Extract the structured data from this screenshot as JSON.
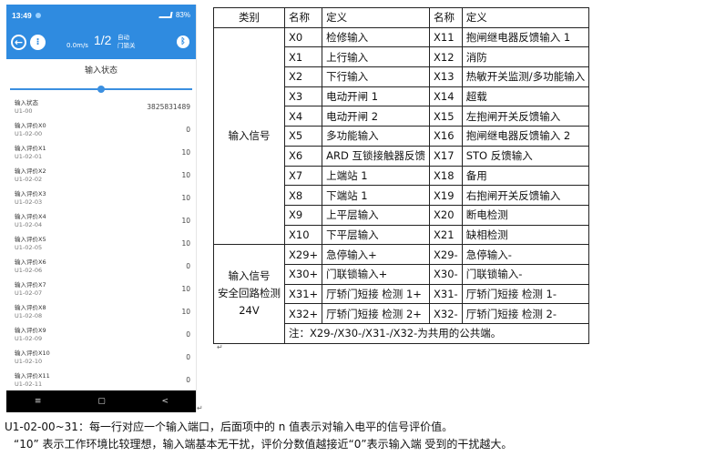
{
  "phone": {
    "status": {
      "time": "13:49",
      "battery": "83%"
    },
    "appbar": {
      "speed": "0.0m/s",
      "floor": "1/2",
      "mode": "自动",
      "door": "门锁关"
    },
    "title": "输入状态",
    "slider": {
      "position_fraction": 0.5
    },
    "rows": [
      {
        "label": "输入状态",
        "code": "U1-00",
        "value": "3825831489"
      },
      {
        "label": "输入评价X0",
        "code": "U1-02-00",
        "value": "0"
      },
      {
        "label": "输入评价X1",
        "code": "U1-02-01",
        "value": "10"
      },
      {
        "label": "输入评价X2",
        "code": "U1-02-02",
        "value": "10"
      },
      {
        "label": "输入评价X3",
        "code": "U1-02-03",
        "value": "10"
      },
      {
        "label": "输入评价X4",
        "code": "U1-02-04",
        "value": "10"
      },
      {
        "label": "输入评价X5",
        "code": "U1-02-05",
        "value": "10"
      },
      {
        "label": "输入评价X6",
        "code": "U1-02-06",
        "value": "0"
      },
      {
        "label": "输入评价X7",
        "code": "U1-02-07",
        "value": "10"
      },
      {
        "label": "输入评价X8",
        "code": "U1-02-08",
        "value": "10"
      },
      {
        "label": "输入评价X9",
        "code": "U1-02-09",
        "value": "0"
      },
      {
        "label": "输入评价X10",
        "code": "U1-02-10",
        "value": "0"
      },
      {
        "label": "输入评价X11",
        "code": "U1-02-11",
        "value": "0"
      }
    ],
    "nav": {
      "menu": "≡",
      "home": "▢",
      "back": "<"
    }
  },
  "table": {
    "headers": [
      "类别",
      "名称",
      "定义",
      "名称",
      "定义"
    ],
    "group1_label": "输入信号",
    "group1_rows": [
      [
        "X0",
        "检修输入",
        "X11",
        "抱闸继电器反馈输入 1"
      ],
      [
        "X1",
        "上行输入",
        "X12",
        "消防"
      ],
      [
        "X2",
        "下行输入",
        "X13",
        "热敏开关监测/多功能输入"
      ],
      [
        "X3",
        "电动开闸 1",
        "X14",
        "超载"
      ],
      [
        "X4",
        "电动开闸 2",
        "X15",
        "左抱闸开关反馈输入"
      ],
      [
        "X5",
        "多功能输入",
        "X16",
        "抱闸继电器反馈输入 2"
      ],
      [
        "X6",
        "ARD 互锁接触器反馈",
        "X17",
        "STO 反馈输入"
      ],
      [
        "X7",
        "上端站 1",
        "X18",
        "备用"
      ],
      [
        "X8",
        "下端站 1",
        "X19",
        "右抱闸开关反馈输入"
      ],
      [
        "X9",
        "上平层输入",
        "X20",
        "断电检测"
      ],
      [
        "X10",
        "下平层输入",
        "X21",
        "缺相检测"
      ]
    ],
    "group2_label": [
      "输入信号",
      "安全回路检测",
      "24V"
    ],
    "group2_rows": [
      [
        "X29+",
        "急停输入+",
        "X29-",
        "急停输入-"
      ],
      [
        "X30+",
        "门联锁输入+",
        "X30-",
        "门联锁输入-"
      ],
      [
        "X31+",
        "厅轿门短接 检测 1+",
        "X31-",
        "厅轿门短接 检测 1-"
      ],
      [
        "X32+",
        "厅轿门短接 检测 2+",
        "X32-",
        "厅轿门短接 检测 2-"
      ]
    ],
    "note": "注：X29-/X30-/X31-/X32-为共用的公共端。"
  },
  "body_text": {
    "line1": "U1-02-00~31：每一行对应一个输入端口，后面项中的 n 值表示对输入电平的信号评价值。",
    "line2": "“10” 表示工作环境比较理想，输入端基本无干扰，评价分数值越接近“0”表示输入端 受到的干扰越大。"
  }
}
